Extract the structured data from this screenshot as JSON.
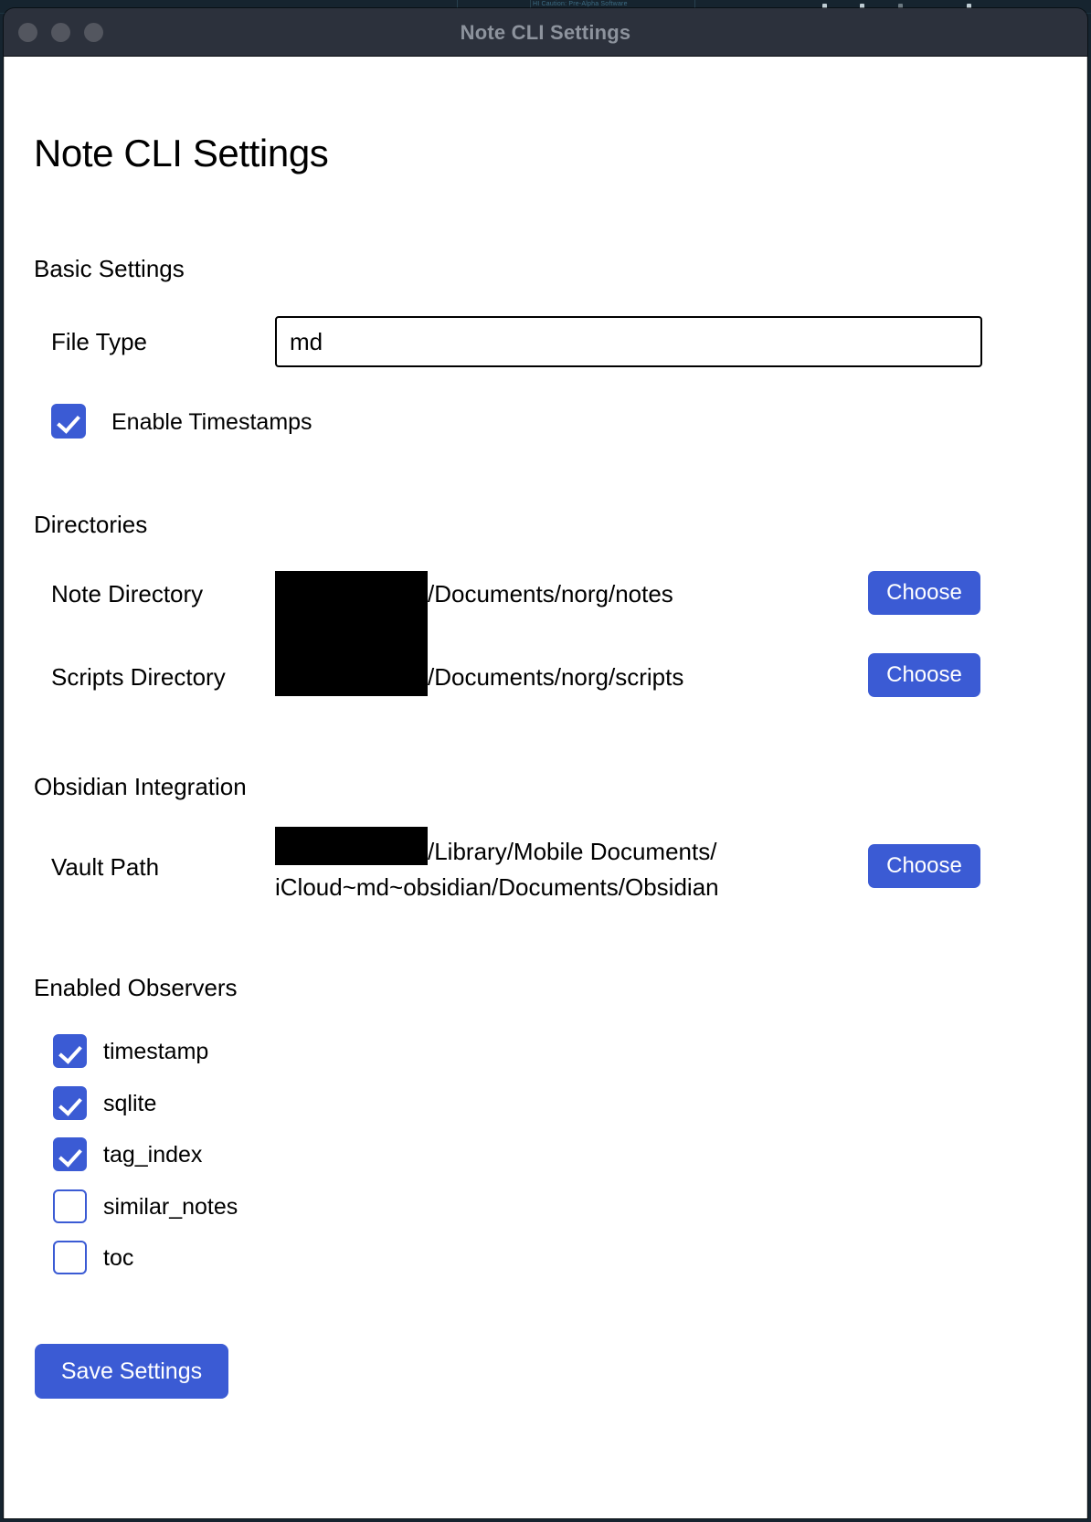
{
  "desktop": {
    "menubar_text": "HI Caution: Pre-Alpha Software"
  },
  "window": {
    "title": "Note CLI Settings",
    "traffic_lights": [
      "close-button",
      "minimize-button",
      "maximize-button"
    ]
  },
  "page": {
    "title": "Note CLI Settings"
  },
  "basic": {
    "heading": "Basic Settings",
    "file_type": {
      "label": "File Type",
      "value": "md",
      "placeholder": "md"
    },
    "timestamps": {
      "label": "Enable Timestamps",
      "checked": true
    }
  },
  "directories": {
    "heading": "Directories",
    "rows": [
      {
        "label": "Note Directory",
        "path": "/Documents/norg/notes",
        "redacted": true,
        "button": "Choose"
      },
      {
        "label": "Scripts Directory",
        "path": "/Documents/norg/scripts",
        "redacted": true,
        "button": "Choose"
      }
    ]
  },
  "obsidian": {
    "heading": "Obsidian Integration",
    "vault": {
      "label": "Vault Path",
      "path_line1": "/Library/Mobile Documents/",
      "path_line2": "iCloud~md~obsidian/Documents/Obsidian",
      "redacted": true,
      "button": "Choose"
    }
  },
  "observers": {
    "heading": "Enabled Observers",
    "items": [
      {
        "label": "timestamp",
        "checked": true
      },
      {
        "label": "sqlite",
        "checked": true
      },
      {
        "label": "tag_index",
        "checked": true
      },
      {
        "label": "similar_notes",
        "checked": false
      },
      {
        "label": "toc",
        "checked": false
      }
    ]
  },
  "footer": {
    "save_label": "Save Settings"
  },
  "colors": {
    "accent": "#3b5bd4",
    "titlebar": "#2c313c",
    "title_text": "#8d939d",
    "desktop": "#16242f",
    "content_bg": "#ffffff",
    "text": "#000000"
  }
}
